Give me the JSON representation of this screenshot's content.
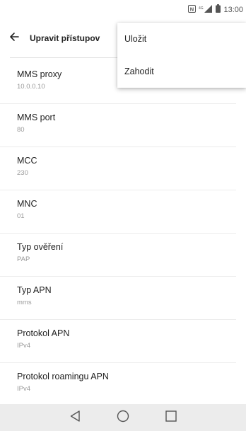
{
  "status_bar": {
    "time": "13:00",
    "icons": [
      "nfc-icon",
      "signal-icon",
      "battery-icon"
    ]
  },
  "app_bar": {
    "title": "Upravit přístupov",
    "back_icon": "arrow-back-icon"
  },
  "menu": {
    "items": [
      {
        "label": "Uložit"
      },
      {
        "label": "Zahodit"
      }
    ]
  },
  "settings": {
    "items": [
      {
        "label": "MMS proxy",
        "value": "10.0.0.10"
      },
      {
        "label": "MMS port",
        "value": "80"
      },
      {
        "label": "MCC",
        "value": "230"
      },
      {
        "label": "MNC",
        "value": "01"
      },
      {
        "label": "Typ ověření",
        "value": "PAP"
      },
      {
        "label": "Typ APN",
        "value": "mms"
      },
      {
        "label": "Protokol APN",
        "value": "IPv4"
      },
      {
        "label": "Protokol roamingu APN",
        "value": "IPv4"
      }
    ]
  },
  "nav_bar": {
    "icons": [
      "back-triangle-icon",
      "home-circle-icon",
      "recents-square-icon"
    ]
  }
}
